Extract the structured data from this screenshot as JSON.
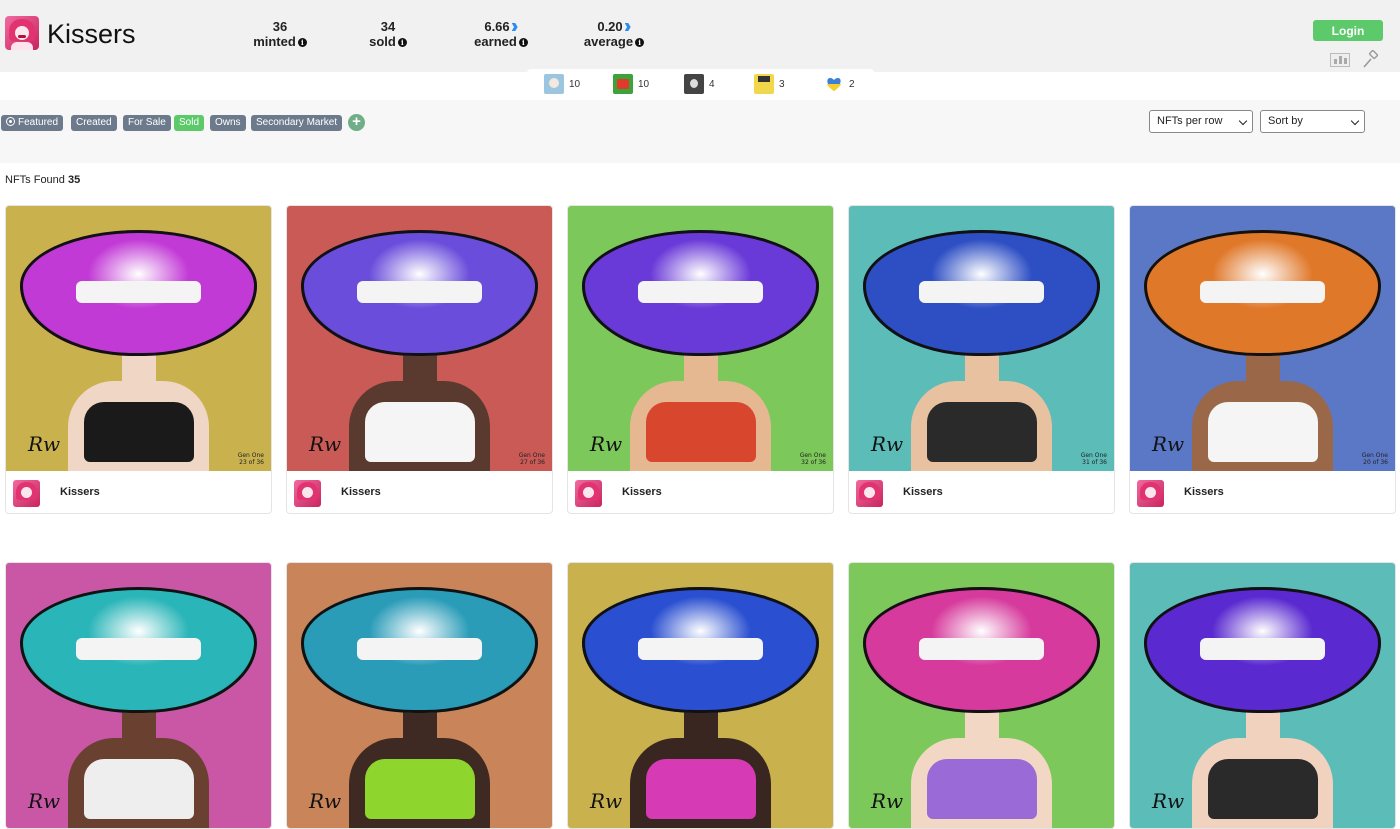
{
  "collection": {
    "title": "Kissers"
  },
  "stats": [
    {
      "value": "36",
      "label": "minted",
      "currency": false
    },
    {
      "value": "34",
      "label": "sold",
      "currency": false
    },
    {
      "value": "6.66",
      "label": "earned",
      "currency": true
    },
    {
      "value": "0.20",
      "label": "average",
      "currency": true
    }
  ],
  "header": {
    "login_label": "Login",
    "icons": [
      "chart-icon",
      "auction-hammer-icon"
    ]
  },
  "owners": [
    {
      "count": "10",
      "color": "#9cc6e0"
    },
    {
      "count": "10",
      "color": "#3aa33a"
    },
    {
      "count": "4",
      "color": "#444444"
    },
    {
      "count": "3",
      "color": "#f2d74a"
    },
    {
      "count": "2",
      "color": "#3d7fd6"
    }
  ],
  "filters": {
    "tabs": [
      "Featured",
      "Created",
      "For Sale",
      "Sold",
      "Owns",
      "Secondary Market"
    ],
    "active_tab": "Sold",
    "per_row_label": "NFTs per row",
    "sort_label": "Sort by"
  },
  "results": {
    "label": "NFTs Found",
    "count": "35"
  },
  "cards": [
    {
      "name": "Kissers",
      "edition": "23 of 36",
      "series": "Gen One",
      "bg": "#c9b24e",
      "lips": "#c23ad6",
      "skin": "#f0d6c4",
      "top": "#1a1a1a"
    },
    {
      "name": "Kissers",
      "edition": "27 of 36",
      "series": "Gen One",
      "bg": "#c95a56",
      "lips": "#6a4ddb",
      "skin": "#5a3a2e",
      "top": "#f5f5f5"
    },
    {
      "name": "Kissers",
      "edition": "32 of 36",
      "series": "Gen One",
      "bg": "#7cc85a",
      "lips": "#6a3ad8",
      "skin": "#e6b892",
      "top": "#d9462e"
    },
    {
      "name": "Kissers",
      "edition": "31 of 36",
      "series": "Gen One",
      "bg": "#5cbcb8",
      "lips": "#2e4fc4",
      "skin": "#e8c2a0",
      "top": "#2a2a2a"
    },
    {
      "name": "Kissers",
      "edition": "20 of 36",
      "series": "Gen One",
      "bg": "#5b78c6",
      "lips": "#e0782a",
      "skin": "#9a6848",
      "top": "#f5f5f5"
    },
    {
      "name": "",
      "edition": "",
      "series": "",
      "bg": "#c957a6",
      "lips": "#2ab5b8",
      "skin": "#6a4030",
      "top": "#eeeeee"
    },
    {
      "name": "",
      "edition": "",
      "series": "",
      "bg": "#c9845a",
      "lips": "#2a9cb8",
      "skin": "#3e2a22",
      "top": "#8ed62e"
    },
    {
      "name": "",
      "edition": "",
      "series": "",
      "bg": "#c9b24e",
      "lips": "#2a4fd0",
      "skin": "#3a2620",
      "top": "#d63ab5"
    },
    {
      "name": "",
      "edition": "",
      "series": "",
      "bg": "#7cc85a",
      "lips": "#d63a9c",
      "skin": "#f2d8c4",
      "top": "#9a6ad6"
    },
    {
      "name": "",
      "edition": "",
      "series": "",
      "bg": "#5cbcb8",
      "lips": "#5a2ad0",
      "skin": "#f0d2be",
      "top": "#2a2a2a"
    }
  ]
}
